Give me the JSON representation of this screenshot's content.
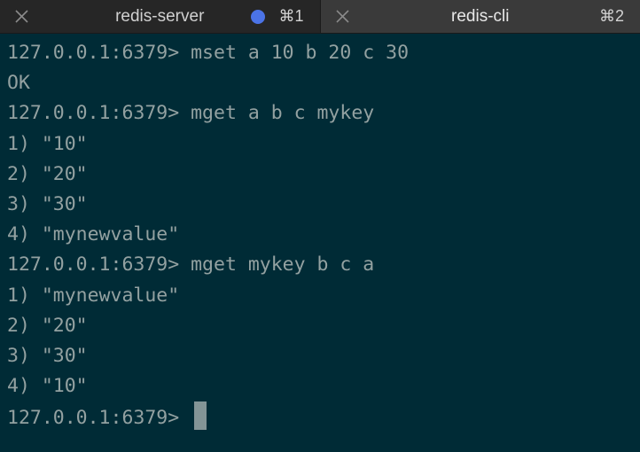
{
  "tabs": [
    {
      "title": "redis-server",
      "shortcut": "⌘1",
      "active": false,
      "has_activity_dot": true,
      "dot_color": "#4b73e6",
      "close_icon": "close-icon"
    },
    {
      "title": "redis-cli",
      "shortcut": "⌘2",
      "active": true,
      "has_activity_dot": false,
      "close_icon": "close-icon"
    }
  ],
  "colors": {
    "terminal_background": "#002b36",
    "terminal_text": "#93a1a1",
    "cursor": "#839496",
    "tabbar_background": "#2b2b2b",
    "active_tab_background": "#3a3a3a"
  },
  "terminal": {
    "lines": [
      "127.0.0.1:6379> mset a 10 b 20 c 30",
      "OK",
      "127.0.0.1:6379> mget a b c mykey",
      "1) \"10\"",
      "2) \"20\"",
      "3) \"30\"",
      "4) \"mynewvalue\"",
      "127.0.0.1:6379> mget mykey b c a",
      "1) \"mynewvalue\"",
      "2) \"20\"",
      "3) \"30\"",
      "4) \"10\""
    ],
    "prompt": "127.0.0.1:6379> "
  }
}
